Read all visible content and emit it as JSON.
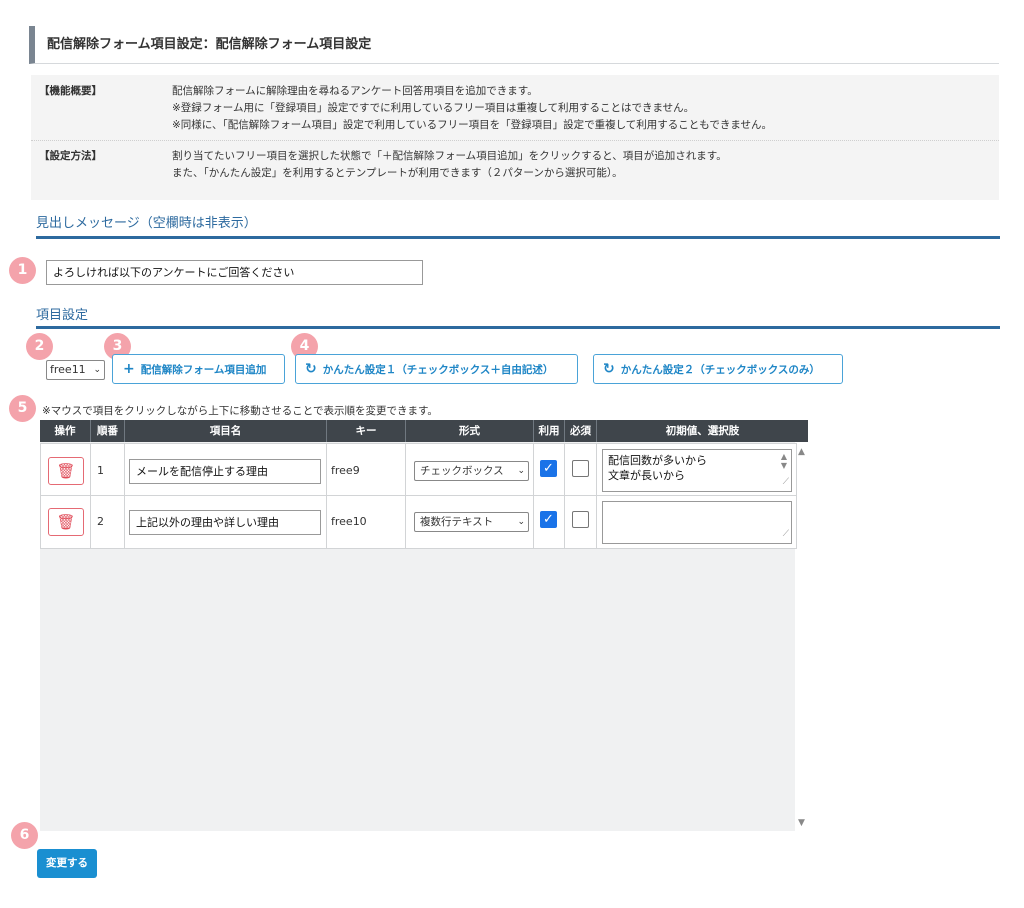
{
  "page": {
    "title": "配信解除フォーム項目設定：配信解除フォーム項目設定"
  },
  "info": {
    "overview_label": "【機能概要】",
    "overview_lines": [
      "配信解除フォームに解除理由を尋ねるアンケート回答用項目を追加できます。",
      "※登録フォーム用に「登録項目」設定ですでに利用しているフリー項目は重複して利用することはできません。",
      "※同様に、「配信解除フォーム項目」設定で利用しているフリー項目を「登録項目」設定で重複して利用することもできません。"
    ],
    "method_label": "【設定方法】",
    "method_lines": [
      "割り当てたいフリー項目を選択した状態で「＋配信解除フォーム項目追加」をクリックすると、項目が追加されます。",
      "また、「かんたん設定」を利用するとテンプレートが利用できます（２パターンから選択可能）。"
    ]
  },
  "heading_section": {
    "title": "見出しメッセージ（空欄時は非表示）",
    "message_value": "よろしければ以下のアンケートにご回答ください"
  },
  "items_section": {
    "title": "項目設定",
    "free_select_value": "free11",
    "add_button_label": "配信解除フォーム項目追加",
    "easy1_label": "かんたん設定１（チェックボックス＋自由記述）",
    "easy2_label": "かんたん設定２（チェックボックスのみ）",
    "note": "※マウスで項目をクリックしながら上下に移動させることで表示順を変更できます。"
  },
  "badges": [
    "1",
    "2",
    "3",
    "4",
    "5",
    "6"
  ],
  "table": {
    "headers": [
      "操作",
      "順番",
      "項目名",
      "キー",
      "形式",
      "利用",
      "必須",
      "初期値、選択肢"
    ],
    "rows": [
      {
        "order": "1",
        "name": "メールを配信停止する理由",
        "key": "free9",
        "type": "チェックボックス",
        "use": true,
        "required": false,
        "options": [
          "配信回数が多いから",
          "文章が長いから"
        ]
      },
      {
        "order": "2",
        "name": "上記以外の理由や詳しい理由",
        "key": "free10",
        "type": "複数行テキスト",
        "use": true,
        "required": false,
        "options": []
      }
    ]
  },
  "submit_label": "変更する",
  "icons": {
    "trash": "trash-icon",
    "plus": "plus-icon",
    "refresh": "refresh-icon",
    "chevron": "chevron-down-icon",
    "check": "checkmark-icon"
  },
  "colors": {
    "accent": "#2d6a9f",
    "button_blue": "#1a8fd1",
    "badge_pink": "#f4a3ab",
    "delete_red": "#e04b58",
    "header_dark": "#3f454b"
  }
}
